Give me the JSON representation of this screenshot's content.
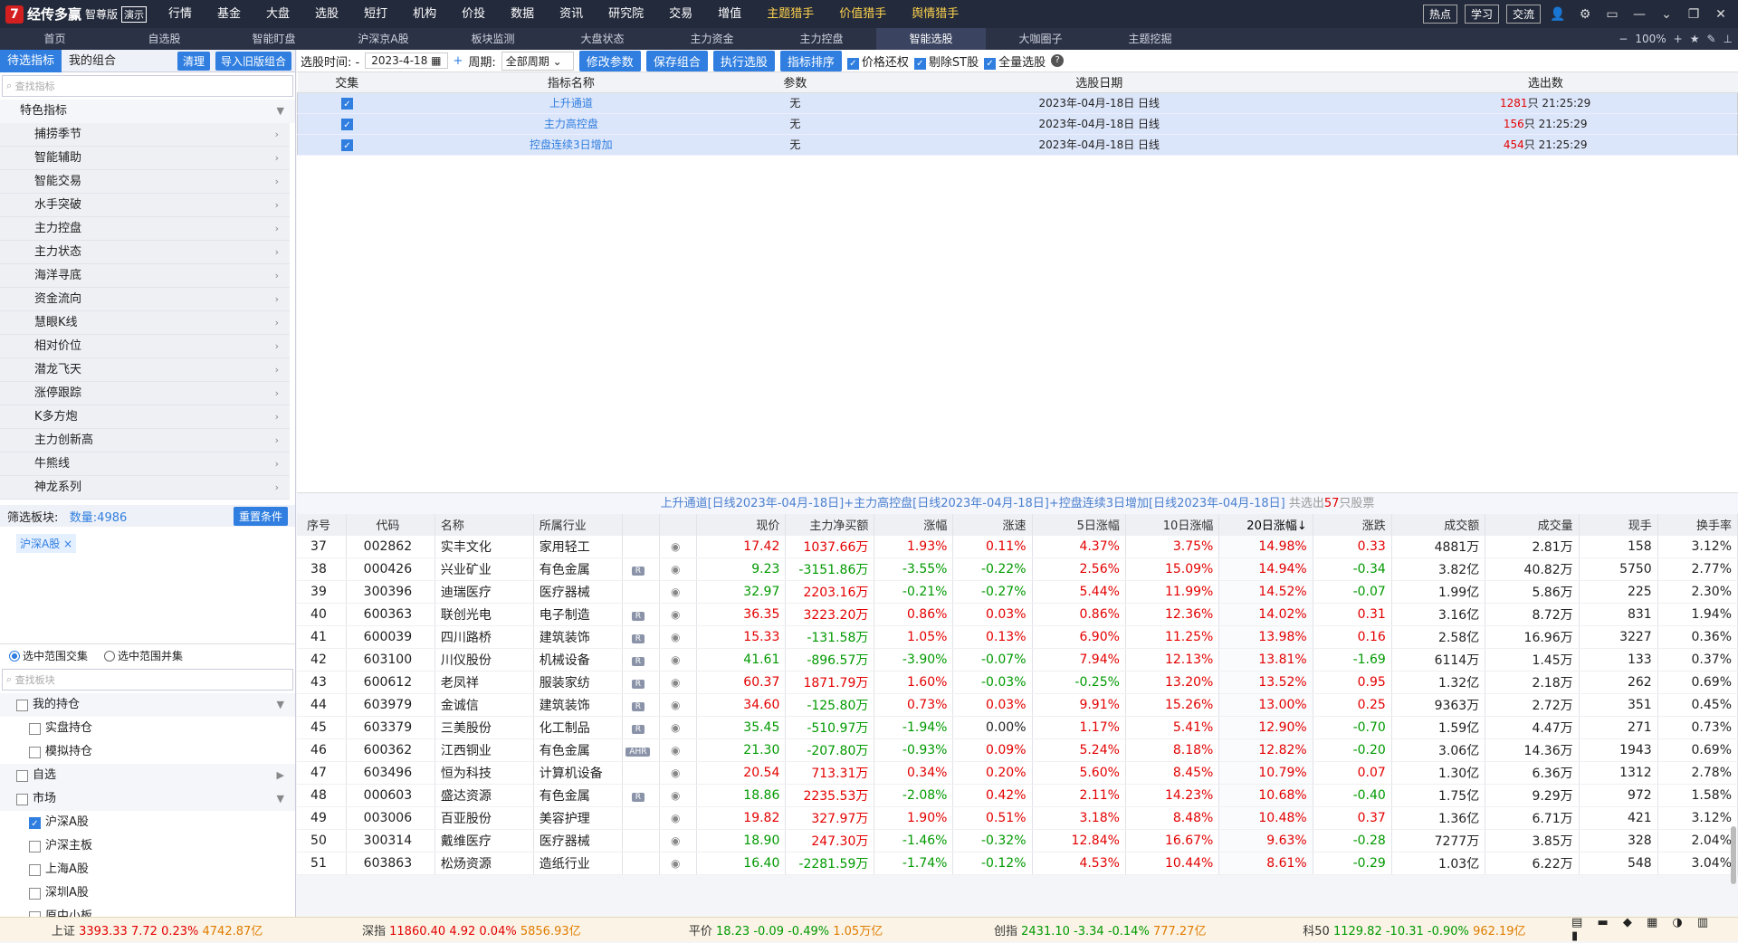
{
  "app": {
    "logo_char": "7",
    "name": "经传多赢",
    "edition": "智尊版",
    "demo": "演示"
  },
  "menu": [
    "行情",
    "基金",
    "大盘",
    "选股",
    "短打",
    "机构",
    "价投",
    "数据",
    "资讯",
    "研究院",
    "交易",
    "增值",
    "主题猎手",
    "价值猎手",
    "舆情猎手"
  ],
  "top_pills": [
    "热点",
    "学习",
    "交流"
  ],
  "nav": [
    "首页",
    "自选股",
    "智能盯盘",
    "沪深京A股",
    "板块监测",
    "大盘状态",
    "主力资金",
    "主力控盘",
    "智能选股",
    "大咖圈子",
    "主题挖掘"
  ],
  "zoom": "100%",
  "sidebar": {
    "tabs": [
      "待选指标",
      "我的组合"
    ],
    "clear": "清理",
    "import": "导入旧版组合",
    "search_placeholder": "查找指标",
    "group": "特色指标",
    "items": [
      "捕捞季节",
      "智能辅助",
      "智能交易",
      "水手突破",
      "主力控盘",
      "主力状态",
      "海洋寻底",
      "资金流向",
      "慧眼K线",
      "相对价位",
      "潜龙飞天",
      "涨停跟踪",
      "K多方炮",
      "主力创新高",
      "牛熊线",
      "神龙系列"
    ],
    "filter_label": "筛选板块:",
    "count": "数量:4986",
    "reset": "重置条件",
    "chip": "沪深A股",
    "radio1": "选中范围交集",
    "radio2": "选中范围并集",
    "search2": "查找板块",
    "tree": [
      {
        "label": "我的持仓",
        "level": 0,
        "checked": false,
        "arrow": "▼"
      },
      {
        "label": "实盘持仓",
        "level": 1,
        "checked": false
      },
      {
        "label": "模拟持仓",
        "level": 1,
        "checked": false
      },
      {
        "label": "自选",
        "level": 0,
        "checked": false,
        "arrow": "▶"
      },
      {
        "label": "市场",
        "level": 0,
        "checked": false,
        "arrow": "▼"
      },
      {
        "label": "沪深A股",
        "level": 1,
        "checked": true
      },
      {
        "label": "沪深主板",
        "level": 1,
        "checked": false
      },
      {
        "label": "上海A股",
        "level": 1,
        "checked": false
      },
      {
        "label": "深圳A股",
        "level": 1,
        "checked": false
      },
      {
        "label": "原中小板",
        "level": 1,
        "checked": false
      }
    ]
  },
  "toolbar": {
    "time_label": "选股时间: -",
    "date": "2023-4-18",
    "period_label": "周期:",
    "period": "全部周期",
    "b1": "修改参数",
    "b2": "保存组合",
    "b3": "执行选股",
    "b4": "指标排序",
    "c1": "价格还权",
    "c2": "剔除ST股",
    "c3": "全量选股"
  },
  "cond_headers": [
    "交集",
    "指标名称",
    "参数",
    "选股日期",
    "选出数"
  ],
  "conditions": [
    {
      "name": "上升通道",
      "param": "无",
      "date": "2023年-04月-18日 日线",
      "num": "1281",
      "time": "只 21:25:29"
    },
    {
      "name": "主力高控盘",
      "param": "无",
      "date": "2023年-04月-18日 日线",
      "num": "156",
      "time": "只 21:25:29"
    },
    {
      "name": "控盘连续3日增加",
      "param": "无",
      "date": "2023年-04月-18日 日线",
      "num": "454",
      "time": "只 21:25:29"
    }
  ],
  "summary": {
    "text": "上升通道[日线2023年-04月-18日]+主力高控盘[日线2023年-04月-18日]+控盘连续3日增加[日线2023年-04月-18日]",
    "pre": "共选出",
    "num": "57",
    "post": "只股票"
  },
  "headers": [
    "序号",
    "代码",
    "名称",
    "所属行业",
    "",
    "",
    "现价",
    "主力净买额",
    "涨幅",
    "涨速",
    "5日涨幅",
    "10日涨幅",
    "20日涨幅↓",
    "涨跌",
    "成交额",
    "成交量",
    "现手",
    "换手率"
  ],
  "rows": [
    [
      "37",
      "002862",
      "实丰文化",
      "家用轻工",
      "",
      "17.42",
      "1037.66万",
      "1.93%",
      "0.11%",
      "4.37%",
      "3.75%",
      "14.98%",
      "0.33",
      "4881万",
      "2.81万",
      "158",
      "3.12%"
    ],
    [
      "38",
      "000426",
      "兴业矿业",
      "有色金属",
      "R",
      "9.23",
      "-3151.86万",
      "-3.55%",
      "-0.22%",
      "2.56%",
      "15.09%",
      "14.94%",
      "-0.34",
      "3.82亿",
      "40.82万",
      "5750",
      "2.77%"
    ],
    [
      "39",
      "300396",
      "迪瑞医疗",
      "医疗器械",
      "",
      "32.97",
      "2203.16万",
      "-0.21%",
      "-0.27%",
      "5.44%",
      "11.99%",
      "14.52%",
      "-0.07",
      "1.99亿",
      "5.86万",
      "225",
      "2.30%"
    ],
    [
      "40",
      "600363",
      "联创光电",
      "电子制造",
      "R",
      "36.35",
      "3223.20万",
      "0.86%",
      "0.03%",
      "0.86%",
      "12.36%",
      "14.02%",
      "0.31",
      "3.16亿",
      "8.72万",
      "831",
      "1.94%"
    ],
    [
      "41",
      "600039",
      "四川路桥",
      "建筑装饰",
      "R",
      "15.33",
      "-131.58万",
      "1.05%",
      "0.13%",
      "6.90%",
      "11.25%",
      "13.98%",
      "0.16",
      "2.58亿",
      "16.96万",
      "3227",
      "0.36%"
    ],
    [
      "42",
      "603100",
      "川仪股份",
      "机械设备",
      "R",
      "41.61",
      "-896.57万",
      "-3.90%",
      "-0.07%",
      "7.94%",
      "12.13%",
      "13.81%",
      "-1.69",
      "6114万",
      "1.45万",
      "133",
      "0.37%"
    ],
    [
      "43",
      "600612",
      "老凤祥",
      "服装家纺",
      "R",
      "60.37",
      "1871.79万",
      "1.60%",
      "-0.03%",
      "-0.25%",
      "13.20%",
      "13.52%",
      "0.95",
      "1.32亿",
      "2.18万",
      "262",
      "0.69%"
    ],
    [
      "44",
      "603979",
      "金诚信",
      "建筑装饰",
      "R",
      "34.60",
      "-125.80万",
      "0.73%",
      "0.03%",
      "9.91%",
      "15.26%",
      "13.00%",
      "0.25",
      "9363万",
      "2.72万",
      "351",
      "0.45%"
    ],
    [
      "45",
      "603379",
      "三美股份",
      "化工制品",
      "R",
      "35.45",
      "-510.97万",
      "-1.94%",
      "0.00%",
      "1.17%",
      "5.41%",
      "12.90%",
      "-0.70",
      "1.59亿",
      "4.47万",
      "271",
      "0.73%"
    ],
    [
      "46",
      "600362",
      "江西铜业",
      "有色金属",
      "AHR",
      "21.30",
      "-207.80万",
      "-0.93%",
      "0.09%",
      "5.24%",
      "8.18%",
      "12.82%",
      "-0.20",
      "3.06亿",
      "14.36万",
      "1943",
      "0.69%"
    ],
    [
      "47",
      "603496",
      "恒为科技",
      "计算机设备",
      "",
      "20.54",
      "713.31万",
      "0.34%",
      "0.20%",
      "5.60%",
      "8.45%",
      "10.79%",
      "0.07",
      "1.30亿",
      "6.36万",
      "1312",
      "2.78%"
    ],
    [
      "48",
      "000603",
      "盛达资源",
      "有色金属",
      "R",
      "18.86",
      "2235.53万",
      "-2.08%",
      "0.42%",
      "2.11%",
      "14.23%",
      "10.68%",
      "-0.40",
      "1.75亿",
      "9.29万",
      "972",
      "1.58%"
    ],
    [
      "49",
      "003006",
      "百亚股份",
      "美容护理",
      "",
      "19.82",
      "327.97万",
      "1.90%",
      "0.51%",
      "3.18%",
      "8.48%",
      "10.48%",
      "0.37",
      "1.36亿",
      "6.71万",
      "421",
      "3.12%"
    ],
    [
      "50",
      "300314",
      "戴维医疗",
      "医疗器械",
      "",
      "18.90",
      "247.30万",
      "-1.46%",
      "-0.32%",
      "12.84%",
      "16.67%",
      "9.63%",
      "-0.28",
      "7277万",
      "3.85万",
      "328",
      "2.04%"
    ],
    [
      "51",
      "603863",
      "松炀资源",
      "造纸行业",
      "",
      "16.40",
      "-2281.59万",
      "-1.74%",
      "-0.12%",
      "4.53%",
      "10.44%",
      "8.61%",
      "-0.29",
      "1.03亿",
      "6.22万",
      "548",
      "3.04%"
    ]
  ],
  "status": [
    {
      "name": "上证",
      "val": "3393.33",
      "chg": "7.72",
      "pct": "0.23%",
      "amt": "4742.87亿",
      "up": true
    },
    {
      "name": "深指",
      "val": "11860.40",
      "chg": "4.92",
      "pct": "0.04%",
      "amt": "5856.93亿",
      "up": true
    },
    {
      "name": "平价",
      "val": "18.23",
      "chg": "-0.09",
      "pct": "-0.49%",
      "amt": "1.05万亿",
      "up": false
    },
    {
      "name": "创指",
      "val": "2431.10",
      "chg": "-3.34",
      "pct": "-0.14%",
      "amt": "777.27亿",
      "up": false
    },
    {
      "name": "科50",
      "val": "1129.82",
      "chg": "-10.31",
      "pct": "-0.90%",
      "amt": "962.19亿",
      "up": false
    }
  ]
}
